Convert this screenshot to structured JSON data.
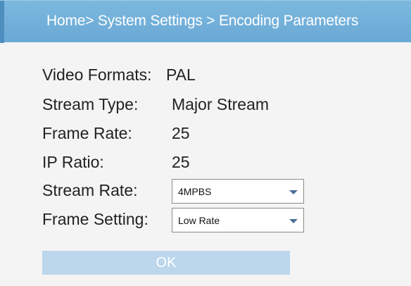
{
  "breadcrumb": "Home> System Settings > Encoding Parameters",
  "fields": {
    "video_formats": {
      "label": "Video Formats:",
      "value": "PAL"
    },
    "stream_type": {
      "label": "Stream Type:",
      "value": "Major Stream"
    },
    "frame_rate": {
      "label": "Frame Rate:",
      "value": "25"
    },
    "ip_ratio": {
      "label": "IP Ratio:",
      "value": "25"
    },
    "stream_rate": {
      "label": "Stream Rate:",
      "value": "4MPBS"
    },
    "frame_setting": {
      "label": "Frame Setting:",
      "value": "Low Rate"
    }
  },
  "ok_label": "OK",
  "colors": {
    "header": "#6aa9d6",
    "ok_button": "#bcd6ec",
    "dropdown_arrow": "#4a6f9a"
  }
}
